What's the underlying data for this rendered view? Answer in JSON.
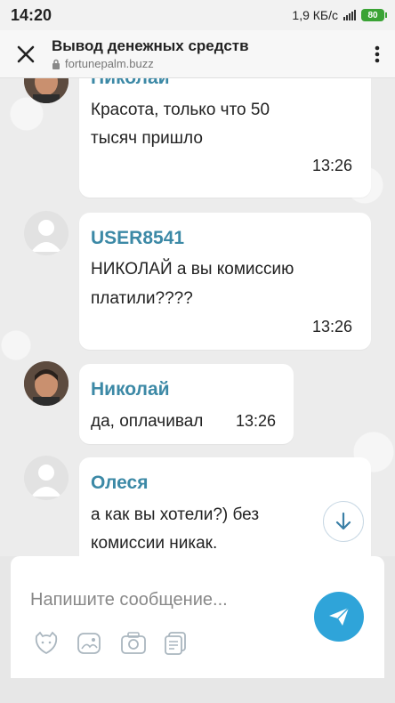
{
  "status_bar": {
    "time": "14:20",
    "network_speed": "1,9 КБ/с",
    "battery": "80"
  },
  "app_bar": {
    "title": "Вывод денежных средств",
    "url": "fortunepalm.buzz"
  },
  "messages": [
    {
      "author": "Николай",
      "lines": [
        "Красота, только что 50",
        "тысяч пришло"
      ],
      "time": "13:26",
      "avatar": "photo"
    },
    {
      "author": "USER8541",
      "lines": [
        "НИКОЛАЙ а вы комиссию",
        "платили????"
      ],
      "time": "13:26",
      "avatar": "default"
    },
    {
      "author": "Николай",
      "lines": [
        "да, оплачивал"
      ],
      "time": "13:26",
      "avatar": "photo"
    },
    {
      "author": "Олеся",
      "lines": [
        "а как вы хотели?) без",
        "комиссии никак."
      ],
      "time": "",
      "avatar": "default"
    }
  ],
  "composer": {
    "placeholder": "Напишите сообщение..."
  },
  "colors": {
    "author": "#3c89a6",
    "send_button": "#2fa4d9",
    "battery": "#3aa335"
  },
  "icons": {
    "close": "close-icon",
    "lock": "lock-icon",
    "menu": "more-vertical-icon",
    "scroll": "arrow-down-icon",
    "send": "send-icon",
    "emoji": "emoji-icon",
    "sticker": "sticker-icon",
    "camera": "camera-icon",
    "files": "files-icon"
  }
}
